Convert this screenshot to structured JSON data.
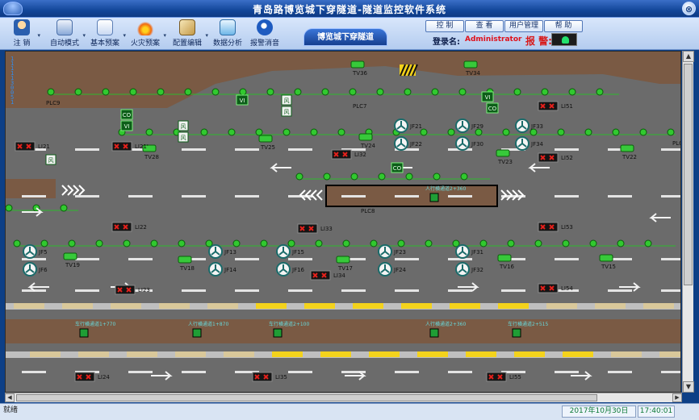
{
  "window": {
    "title": "青岛路博览城下穿隧道-隧道监控软件系统",
    "close_glyph": "⊗"
  },
  "toolbar": {
    "buttons": [
      {
        "label": "注 销",
        "icon": "user-logout-icon"
      },
      {
        "label": "自动模式",
        "icon": "auto-mode-icon"
      },
      {
        "label": "基本预案",
        "icon": "checklist-icon"
      },
      {
        "label": "火灾预案",
        "icon": "fire-icon"
      },
      {
        "label": "配置编辑",
        "icon": "config-edit-icon"
      },
      {
        "label": "数据分析",
        "icon": "data-analysis-icon"
      },
      {
        "label": "报警消音",
        "icon": "speaker-mute-icon"
      }
    ],
    "tab": "博览城下穿隧道",
    "right_buttons": [
      "控 制",
      "查 看",
      "用户管理",
      "帮 助"
    ],
    "login_label": "登录名:",
    "login_value": "Administrator",
    "alarm_label": "报 警:"
  },
  "tunnel": {
    "device_labels": {
      "plc": [
        "PLC9",
        "PLC7",
        "PLC8",
        "PLC"
      ],
      "lights": [
        "LI21",
        "LI21'",
        "LI32",
        "LI51",
        "LI52",
        "LI22",
        "LI53",
        "LI33",
        "LI23",
        "LI34",
        "LI54",
        "LI24",
        "LI35",
        "LI55"
      ],
      "cameras": [
        "TV36",
        "TV34",
        "TV25",
        "TV28",
        "TV24",
        "TV23",
        "TV22",
        "TV19",
        "TV18",
        "TV17",
        "TV16",
        "TV15"
      ],
      "fans": [
        "JF21",
        "JF22",
        "JF29",
        "JF30",
        "JF33",
        "JF34",
        "JF5",
        "JF6",
        "JF13",
        "JF14",
        "JF15",
        "JF16",
        "JF23",
        "JF24",
        "JF31",
        "JF32"
      ],
      "sensors": [
        "CO",
        "VI",
        "CO",
        "VI",
        "CO",
        "VI"
      ],
      "wind": [
        "风",
        "风",
        "风",
        "风",
        "风"
      ]
    },
    "crossings": [
      "人行横通道2+360",
      "车行横通道1+770",
      "人行横通道1+870",
      "车行横通道2+100",
      "人行横通道2+360",
      "车行横通道2+515"
    ],
    "ruler": [
      "1",
      "1",
      "1",
      "1",
      "1",
      "3",
      "0",
      "0",
      "5",
      "1"
    ]
  },
  "status": {
    "ready": "就绪",
    "date": "2017年10月30日",
    "time": "17:40:01"
  },
  "colors": {
    "title_bg": "#13479a",
    "road": "#6b6b6b",
    "rock": "#7a5a44",
    "green_lamp": "#31c92f",
    "red_light": "#e3201b",
    "alarm_green": "#24e06d",
    "yellow_curb": "#f4d31c"
  }
}
